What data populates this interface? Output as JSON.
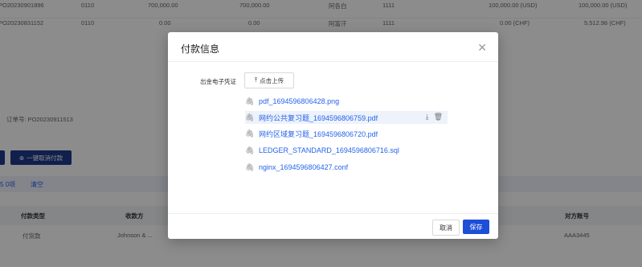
{
  "background": {
    "rows": [
      {
        "id": "PO20230901896",
        "code": "0110",
        "amt1": "700,000.00",
        "amt2": "700,000.00",
        "name": "阿各白",
        "num": "1111",
        "amt3": "100,000.00 (USD)",
        "amt4": "100,000.00 (USD)"
      },
      {
        "id": "PO20230831152",
        "code": "0110",
        "amt1": "0.00",
        "amt2": "0.00",
        "name": "阿富汗",
        "num": "1111",
        "amt3": "0.00 (CHF)",
        "amt4": "5,512.96 (CHF)"
      }
    ],
    "order_label": "订单号: PO20230911513",
    "cancel_all_label": "一键取消付款",
    "selected_count": "5 0项",
    "clear_label": "清空",
    "table_headers": {
      "pay_type": "付款类型",
      "payee": "收款方",
      "account": "对方账号"
    },
    "table_row": {
      "pay_type": "付货款",
      "payee": "Johnson & ...",
      "account": "AAA3445"
    }
  },
  "modal": {
    "title": "付款信息",
    "close_icon": "close-icon",
    "field_label": "出金电子凭证",
    "upload_label": "点击上传",
    "files": [
      {
        "name": "pdf_1694596806428.png"
      },
      {
        "name": "网约公共复习题_1694596806759.pdf",
        "active": true
      },
      {
        "name": "网约区域复习题_1694596806720.pdf"
      },
      {
        "name": "LEDGER_STANDARD_1694596806716.sql"
      },
      {
        "name": "nginx_1694596806427.conf"
      }
    ],
    "cancel_label": "取消",
    "save_label": "保存"
  },
  "colors": {
    "primary": "#1d4ed8",
    "link": "#2563eb",
    "mask": "rgba(0,0,0,0.45)"
  }
}
